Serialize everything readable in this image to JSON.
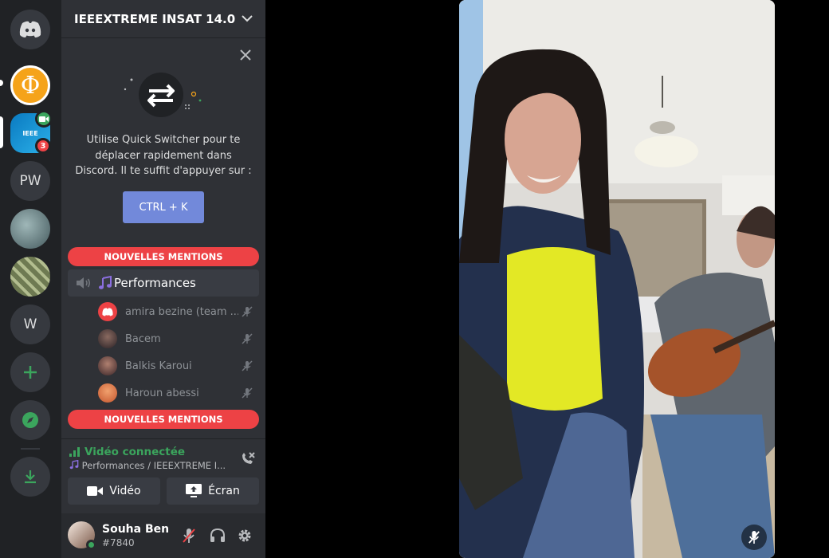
{
  "servers": {
    "home_icon": "discord-logo-icon",
    "phi_symbol": "Φ",
    "ieee_badge_count": "3",
    "pw_label": "PW",
    "w_label": "W",
    "add_icon": "plus-icon",
    "explore_icon": "compass-icon",
    "download_icon": "download-icon"
  },
  "guild": {
    "name": "IEEEXTREME INSAT 14.0"
  },
  "tip": {
    "text": "Utilise Quick Switcher pour te déplacer rapidement dans Discord. Il te suffit d'appuyer sur :",
    "button_label": "CTRL + K"
  },
  "mentions_label_top": "NOUVELLES MENTIONS",
  "mentions_label_bottom": "NOUVELLES MENTIONS",
  "voice_channel": {
    "name": "Performances",
    "members": [
      {
        "name": "amira bezine (team ..."
      },
      {
        "name": "Bacem"
      },
      {
        "name": "Balkis Karoui"
      },
      {
        "name": "Haroun abessi"
      }
    ]
  },
  "voice_panel": {
    "status": "Vidéo connectée",
    "subtitle": "Performances / IEEEXTREME I...",
    "video_label": "Vidéo",
    "screen_label": "Écran"
  },
  "user": {
    "name": "Souha Ben ...",
    "tag": "#7840"
  },
  "colors": {
    "accent": "#7289da",
    "danger": "#ed4245",
    "online": "#3ba55d"
  }
}
